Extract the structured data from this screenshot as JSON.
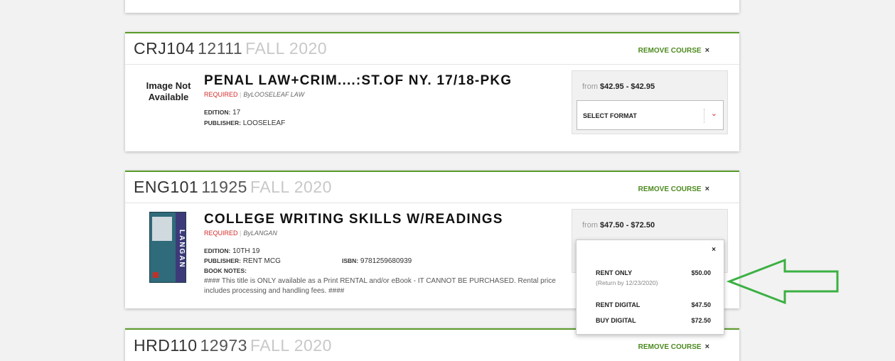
{
  "courses": [
    {
      "code": "CRJ104",
      "section": "12111",
      "term": "FALL 2020",
      "remove_label": "REMOVE COURSE",
      "remove_x": "×",
      "book": {
        "image_text": "Image Not Available",
        "title": "PENAL LAW+CRIM....:ST.OF NY. 17/18-PKG",
        "required": "REQUIRED",
        "by": "ByLOOSELEAF LAW",
        "edition_label": "EDITION:",
        "edition": "17",
        "publisher_label": "PUBLISHER:",
        "publisher": "LOOSELEAF",
        "price_from_label": "from",
        "price_range": "$42.95 - $42.95",
        "select_label": "SELECT FORMAT"
      }
    },
    {
      "code": "ENG101",
      "section": "11925",
      "term": "FALL 2020",
      "remove_label": "REMOVE COURSE",
      "remove_x": "×",
      "book": {
        "cover_spine": "LANGAN",
        "title": "COLLEGE WRITING SKILLS W/READINGS",
        "required": "REQUIRED",
        "by": "ByLANGAN",
        "edition_label": "EDITION:",
        "edition": "10TH 19",
        "publisher_label": "PUBLISHER:",
        "publisher": "RENT MCG",
        "isbn_label": "ISBN:",
        "isbn": "9781259680939",
        "notes_label": "BOOK NOTES:",
        "notes": "#### This title is ONLY available as a Print RENTAL and/or eBook - IT CANNOT BE PURCHASED. Rental price includes processing and handling fees. ####",
        "price_from_label": "from",
        "price_range": "$47.50 - $72.50"
      }
    },
    {
      "code": "HRD110",
      "section": "12973",
      "term": "FALL 2020",
      "remove_label": "REMOVE COURSE",
      "remove_x": "×"
    }
  ],
  "format_popup": {
    "close": "×",
    "options": [
      {
        "name": "RENT ONLY",
        "price": "$50.00",
        "note": "(Return by 12/23/2020)"
      },
      {
        "name": "RENT DIGITAL",
        "price": "$47.50"
      },
      {
        "name": "BUY DIGITAL",
        "price": "$72.50"
      }
    ]
  },
  "colors": {
    "accent_green": "#5a9a2a",
    "required_red": "#d42b2b",
    "arrow_green": "#3cb043"
  }
}
